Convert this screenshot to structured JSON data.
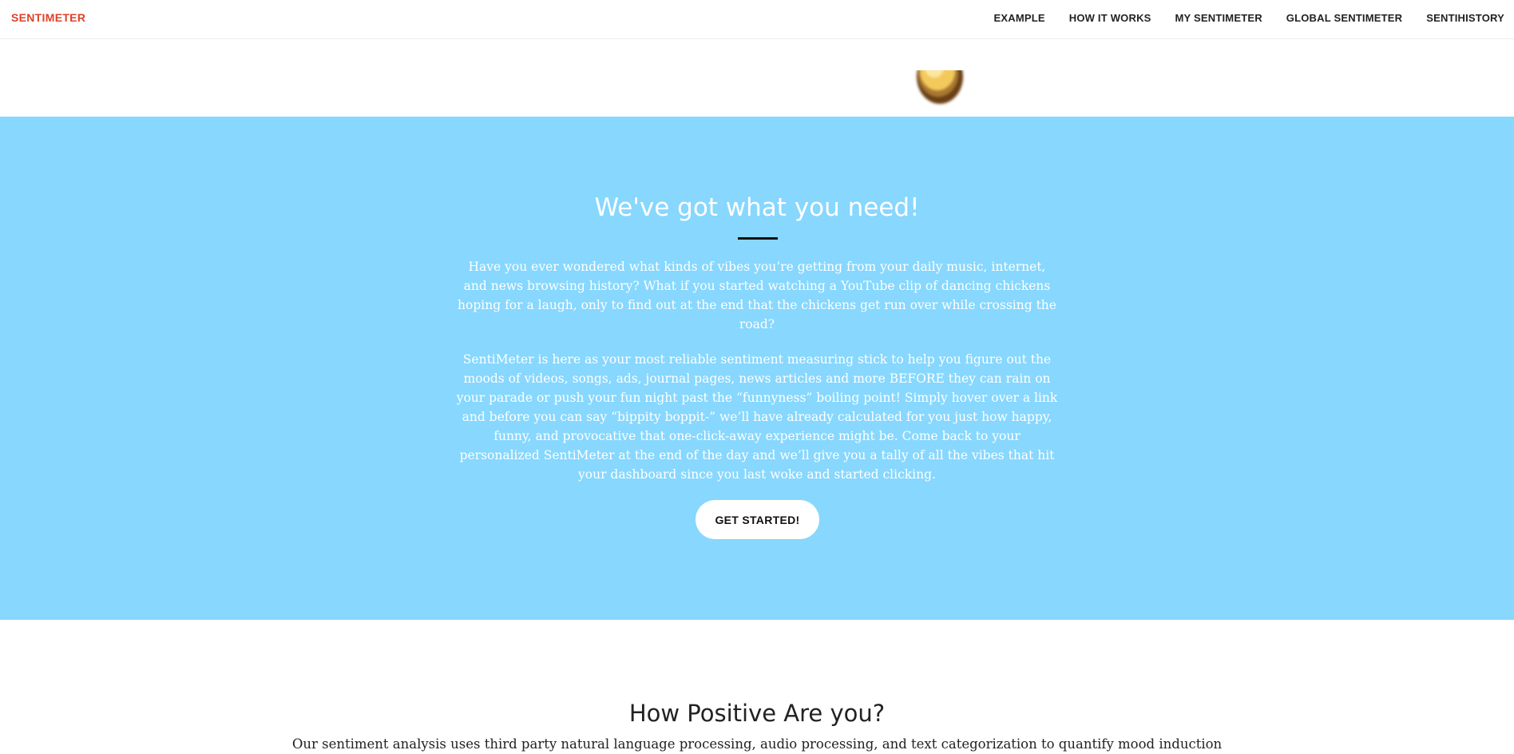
{
  "navbar": {
    "brand": "SENTIMETER",
    "links": [
      {
        "label": "EXAMPLE"
      },
      {
        "label": "HOW IT WORKS"
      },
      {
        "label": "MY SENTIMETER"
      },
      {
        "label": "GLOBAL SENTIMETER"
      },
      {
        "label": "SENTIHISTORY"
      }
    ]
  },
  "hero": {
    "icon": "egg-icon"
  },
  "intro": {
    "heading": "We've got what you need!",
    "paragraph1": "Have you ever wondered what kinds of vibes you’re getting from your daily music, internet, and news browsing history? What if you started watching a YouTube clip of dancing chickens hoping for a laugh, only to find out at the end that the chickens get run over while crossing the road?",
    "paragraph2": "SentiMeter is here as your most reliable sentiment measuring stick to help you figure out the moods of videos, songs, ads, journal pages, news articles and more BEFORE they can rain on your parade or push your fun night past the “funnyness” boiling point! Simply hover over a link and before you can say “bippity boppit-” we’ll have already calculated for you just how happy, funny, and provocative that one-click-away experience might be. Come back to your personalized SentiMeter at the end of the day and we’ll give you a tally of all the vibes that hit your dashboard since you last woke and started clicking.",
    "cta_label": "GET STARTED!"
  },
  "positivity": {
    "heading": "How Positive Are you?",
    "paragraph": "Our sentiment analysis uses third party natural language processing, audio processing, and text categorization to quantify mood induction"
  },
  "colors": {
    "brand": "#e0412a",
    "section_bg": "#87d7fe",
    "button_bg": "#ffffff"
  }
}
